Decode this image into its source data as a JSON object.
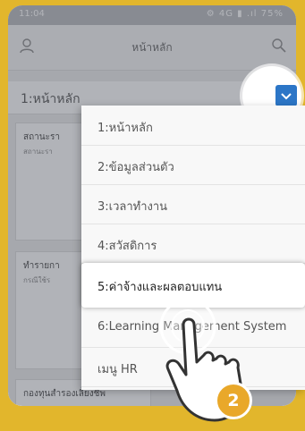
{
  "status_bar": {
    "time": "11:04",
    "icons": "⚙ 4G ▮ .ıl 75%"
  },
  "header": {
    "title": "หน้าหลัก"
  },
  "page_select": {
    "value": "1:หน้าหลัก"
  },
  "cards": [
    {
      "title": "สถานะรา",
      "sub": "สถานะรา"
    },
    {
      "title": "ทำรายกา",
      "sub": "กรณีใช้ร"
    },
    {
      "title": "กองทุนสำรองเลี้ยงชีพ",
      "sub": ""
    }
  ],
  "menu": {
    "items": [
      {
        "label": "1:หน้าหลัก"
      },
      {
        "label": "2:ข้อมูลส่วนตัว"
      },
      {
        "label": "3:เวลาทำงาน"
      },
      {
        "label": "4:สวัสดิการ"
      },
      {
        "label": "5:ค่าจ้างและผลตอบแทน"
      },
      {
        "label": "6:Learning Management System"
      },
      {
        "label": "เมนู HR"
      }
    ],
    "highlighted_index": 4
  },
  "step_badge": "2",
  "colors": {
    "background": "#e2b62c",
    "accent": "#2c76c7",
    "badge": "#e9a82a"
  }
}
